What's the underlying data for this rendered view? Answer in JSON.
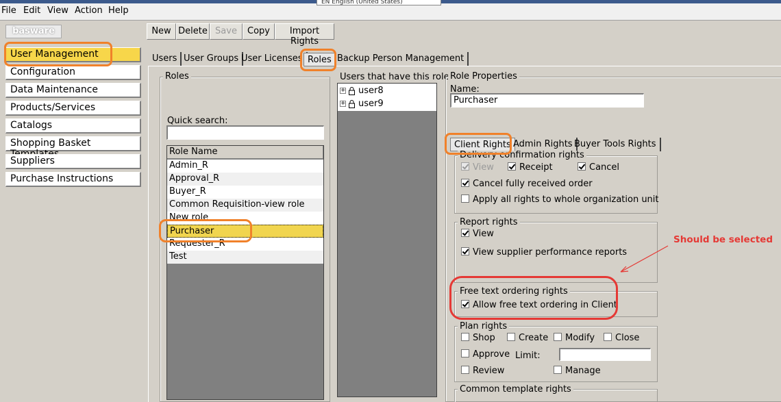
{
  "menu": {
    "items": [
      "File",
      "Edit",
      "View",
      "Action",
      "Help"
    ],
    "language": "EN English (United States)"
  },
  "logo": "basware",
  "toolbar": {
    "new_label": "New",
    "delete_label": "Delete",
    "save_label": "Save",
    "copy_label": "Copy",
    "import_label": "Import Rights"
  },
  "sidebar": {
    "items": [
      {
        "label": "User Management",
        "active": true
      },
      {
        "label": "Configuration"
      },
      {
        "label": "Data Maintenance"
      },
      {
        "label": "Products/Services"
      },
      {
        "label": "Catalogs"
      },
      {
        "label": "Shopping Basket Templates"
      },
      {
        "label": "Suppliers"
      },
      {
        "label": "Purchase Instructions"
      }
    ]
  },
  "main_tabs": [
    "Users",
    "User Groups",
    "User Licenses",
    "Roles",
    "Backup Person Management"
  ],
  "active_main_tab": "Roles",
  "roles_panel": {
    "title": "Roles",
    "quick_search_label": "Quick search:",
    "quick_search_value": "",
    "column_header": "Role Name",
    "roles": [
      "Admin_R",
      "Approval_R",
      "Buyer_R",
      "Common Requisition-view role",
      "New role",
      "Purchaser",
      "Requester_R",
      "Test"
    ],
    "selected": "Purchaser"
  },
  "users_panel": {
    "title": "Users that have this role",
    "users": [
      "user8",
      "user9"
    ]
  },
  "properties": {
    "title": "Role Properties",
    "name_label": "Name:",
    "name_value": "Purchaser",
    "tabs": [
      "Client Rights",
      "Admin Rights",
      "Buyer Tools Rights"
    ],
    "active_tab": "Client Rights",
    "delivery": {
      "title": "Delivery confirmation rights",
      "view": "View",
      "receipt": "Receipt",
      "cancel": "Cancel",
      "cancel_fully": "Cancel fully received order",
      "apply_all": "Apply all rights to whole organization unit"
    },
    "report": {
      "title": "Report rights",
      "view": "View",
      "supplier_perf": "View supplier performance reports"
    },
    "free_text": {
      "title": "Free text ordering rights",
      "allow": "Allow free text ordering in Client"
    },
    "plan": {
      "title": "Plan rights",
      "shop": "Shop",
      "create": "Create",
      "modify": "Modify",
      "close": "Close",
      "approve": "Approve",
      "limit_label": "Limit:",
      "limit_value": "",
      "review": "Review",
      "manage": "Manage"
    },
    "common_template": {
      "title": "Common template rights"
    }
  },
  "annotation": {
    "note": "Should be selected",
    "accent_orange": "#f0812a",
    "accent_red": "#e53935"
  }
}
